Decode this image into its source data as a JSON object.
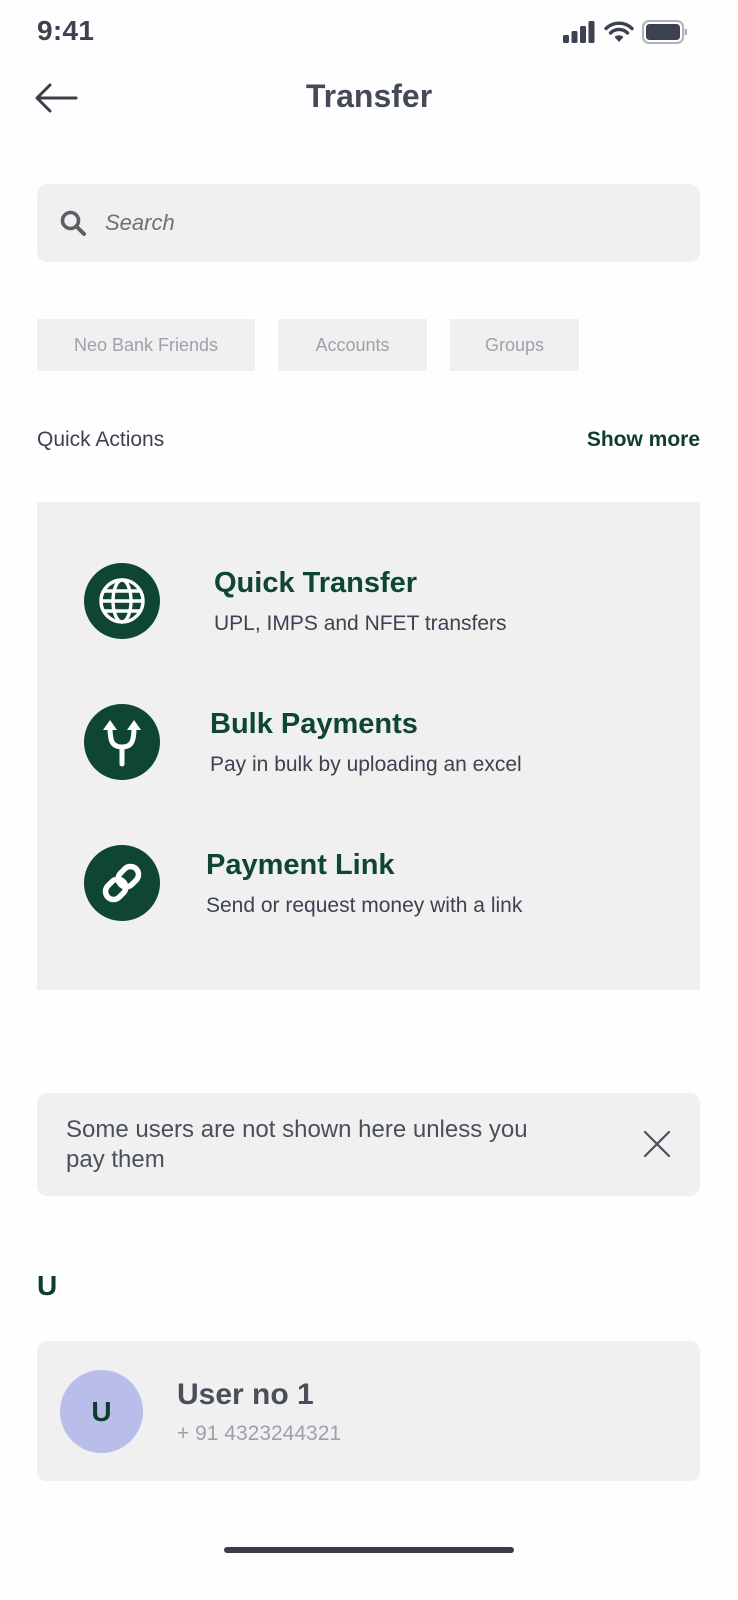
{
  "status_bar": {
    "time": "9:41",
    "icons": [
      "signal-icon",
      "wifi-icon",
      "battery-icon"
    ]
  },
  "nav": {
    "back_icon": "arrow-left-icon",
    "title": "Transfer"
  },
  "search": {
    "icon": "search-icon",
    "placeholder": "Search",
    "value": ""
  },
  "filters": [
    {
      "label": "Neo Bank Friends"
    },
    {
      "label": "Accounts"
    },
    {
      "label": "Groups"
    }
  ],
  "quick_actions": {
    "title": "Quick Actions",
    "show_more": "Show more",
    "items": [
      {
        "icon": "globe-icon",
        "name": "Quick Transfer",
        "description": "UPL, IMPS and NFET transfers"
      },
      {
        "icon": "split-arrows-icon",
        "name": "Bulk Payments",
        "description": "Pay in bulk by uploading an excel"
      },
      {
        "icon": "link-icon",
        "name": "Payment Link",
        "description": "Send or request money with a link"
      }
    ]
  },
  "notice": {
    "text": "Some users are not shown here unless you pay them",
    "close_icon": "close-icon"
  },
  "contacts": {
    "section_letter": "U",
    "items": [
      {
        "initial": "U",
        "name": "User no 1",
        "phone": "+ 91 4323244321"
      }
    ]
  },
  "colors": {
    "brand_green": "#0f4533",
    "surface": "#f0f0f0",
    "avatar_bg": "#b8bde9",
    "text_primary": "#454b56",
    "text_muted": "#9ca1aa"
  }
}
